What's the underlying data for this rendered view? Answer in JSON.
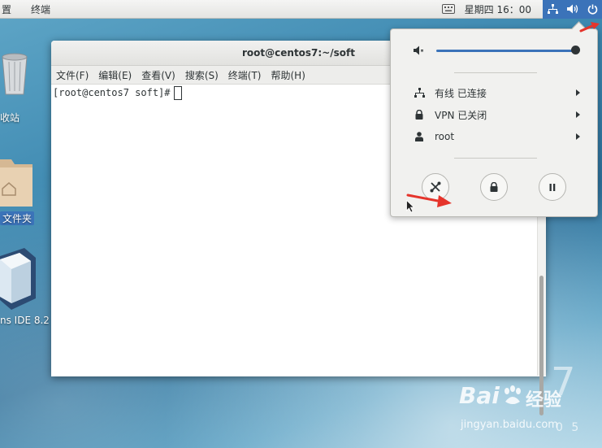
{
  "topbar": {
    "menu_left_1": "置",
    "menu_left_2": "终端",
    "clock": "星期四 16：00",
    "icons": [
      "keyboard-icon",
      "network-icon",
      "volume-icon",
      "power-icon"
    ]
  },
  "desktop": {
    "trash_label": "收站",
    "home_label": "文件夹",
    "netbeans_label": "ns IDE 8.2",
    "background_number": "7",
    "background_text": "0 5"
  },
  "terminal": {
    "title": "root@centos7:~/soft",
    "menu": [
      "文件(F)",
      "编辑(E)",
      "查看(V)",
      "搜索(S)",
      "终端(T)",
      "帮助(H)"
    ],
    "prompt": "[root@centos7 soft]#"
  },
  "system_menu": {
    "volume_level": 1.0,
    "items": [
      {
        "label": "有线 已连接",
        "icon": "network-icon"
      },
      {
        "label": "VPN 已关闭",
        "icon": "lock-icon"
      },
      {
        "label": "root",
        "icon": "user-icon"
      }
    ],
    "buttons": [
      "settings-icon",
      "lock-icon",
      "pause-icon"
    ]
  },
  "watermark": {
    "brand": "Bai",
    "brand_suffix": "经验",
    "url": "jingyan.baidu.com"
  },
  "colors": {
    "accent": "#3b73b9",
    "arrow": "#e5342b"
  }
}
